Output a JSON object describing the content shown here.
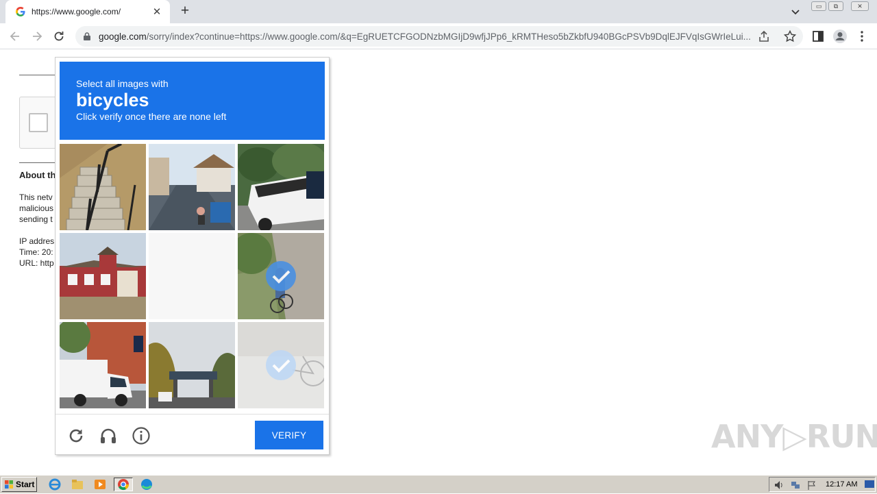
{
  "browser": {
    "tab_title": "https://www.google.com/",
    "tab_close": "✕",
    "new_tab": "+",
    "url_host": "google.com",
    "url_rest": "/sorry/index?continue=https://www.google.com/&q=EgRUETCFGODNzbMGIjD9wfjJPp6_kRMTHeso5bZkbfU940BGcPSVb9DqlEJFVqIsGWrIeLui...",
    "window_controls": [
      "▭",
      "⧉",
      "✕"
    ]
  },
  "page": {
    "about_label": "About th",
    "lines": [
      "This netv",
      "malicious",
      "sending t",
      "IP addres",
      "Time: 20:",
      "URL: http"
    ]
  },
  "captcha": {
    "prompt": "Select all images with",
    "target": "bicycles",
    "instruction": "Click verify once there are none left",
    "verify_label": "VERIFY",
    "tiles": [
      {
        "id": 1,
        "scene": "stairs",
        "selected": false
      },
      {
        "id": 2,
        "scene": "street",
        "selected": false
      },
      {
        "id": 3,
        "scene": "truck",
        "selected": false
      },
      {
        "id": 4,
        "scene": "house",
        "selected": false
      },
      {
        "id": 5,
        "scene": "loading",
        "selected": false
      },
      {
        "id": 6,
        "scene": "bicycle-rider",
        "selected": true
      },
      {
        "id": 7,
        "scene": "van",
        "selected": false
      },
      {
        "id": 8,
        "scene": "bridge",
        "selected": false
      },
      {
        "id": 9,
        "scene": "bicycle-parked",
        "selected": true
      }
    ]
  },
  "watermark": "ANY▷RUN",
  "taskbar": {
    "start_label": "Start",
    "clock": "12:17 AM"
  },
  "colors": {
    "accent": "#1a73e8",
    "tick": "#4a90e2"
  }
}
